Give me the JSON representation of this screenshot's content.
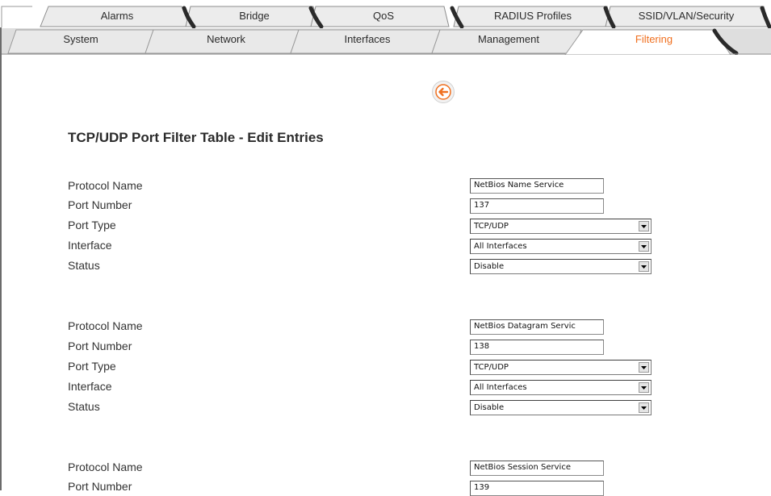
{
  "tabs_row1": [
    "Alarms",
    "Bridge",
    "QoS",
    "RADIUS Profiles",
    "SSID/VLAN/Security"
  ],
  "tabs_row2": [
    "System",
    "Network",
    "Interfaces",
    "Management",
    "Filtering"
  ],
  "active_tab": "Filtering",
  "page_title": "TCP/UDP Port Filter Table - Edit Entries",
  "field_labels": {
    "protocol_name": "Protocol Name",
    "port_number": "Port Number",
    "port_type": "Port Type",
    "interface": "Interface",
    "status": "Status"
  },
  "entries": [
    {
      "protocol_name": "NetBios Name Service",
      "port_number": "137",
      "port_type": "TCP/UDP",
      "interface": "All Interfaces",
      "status": "Disable"
    },
    {
      "protocol_name": "NetBios Datagram Servic",
      "port_number": "138",
      "port_type": "TCP/UDP",
      "interface": "All Interfaces",
      "status": "Disable"
    },
    {
      "protocol_name": "NetBios Session Service",
      "port_number": "139"
    }
  ],
  "colors": {
    "accent": "#f07020",
    "tab_bg": "#e6e6e6",
    "active_tab_bg": "#ffffff"
  },
  "icons": {
    "back": "back-arrow-icon",
    "dropdown": "chevron-down-icon"
  }
}
